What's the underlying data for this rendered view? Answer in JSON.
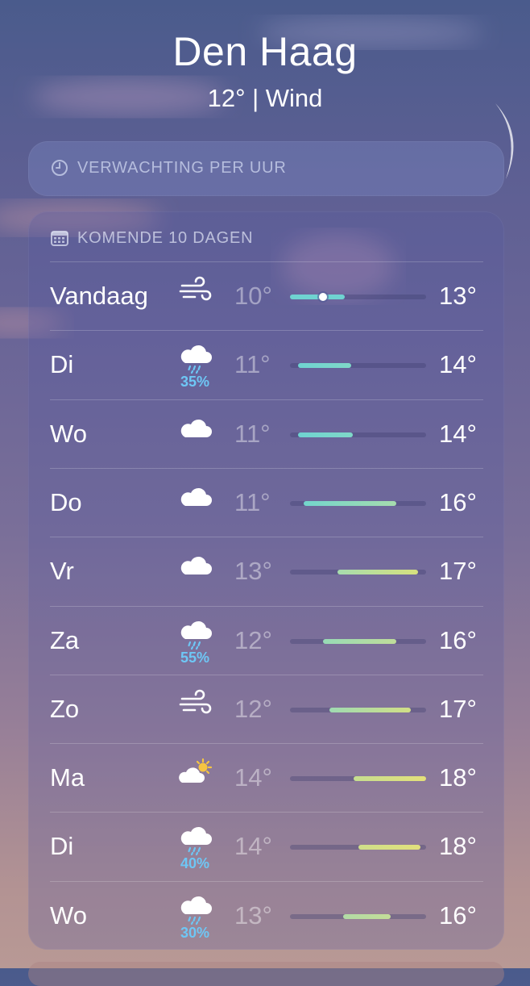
{
  "location": {
    "city": "Den Haag",
    "conditions": "12° | Wind"
  },
  "hourly_forecast": {
    "title": "VERWACHTING PER UUR",
    "icon": "clock-icon"
  },
  "daily_forecast": {
    "title": "KOMENDE 10 DAGEN",
    "icon": "calendar-icon",
    "days": [
      {
        "day": "Vandaag",
        "icon": "wind-icon",
        "precip": "",
        "low": "10°",
        "high": "13°",
        "bar_start": 0.0,
        "bar_end": 0.4,
        "current_marker": 0.24,
        "color_a": "#6fd3d1",
        "color_b": "#6fd3d1"
      },
      {
        "day": "Di",
        "icon": "rain-cloud-icon",
        "precip": "35%",
        "low": "11°",
        "high": "14°",
        "bar_start": 0.06,
        "bar_end": 0.45,
        "current_marker": null,
        "color_a": "#6fd3d1",
        "color_b": "#7fd8c8"
      },
      {
        "day": "Wo",
        "icon": "cloud-icon",
        "precip": "",
        "low": "11°",
        "high": "14°",
        "bar_start": 0.06,
        "bar_end": 0.46,
        "current_marker": null,
        "color_a": "#6fd3d1",
        "color_b": "#7fd8c8"
      },
      {
        "day": "Do",
        "icon": "cloud-icon",
        "precip": "",
        "low": "11°",
        "high": "16°",
        "bar_start": 0.1,
        "bar_end": 0.78,
        "current_marker": null,
        "color_a": "#73d5cc",
        "color_b": "#a6dcae"
      },
      {
        "day": "Vr",
        "icon": "cloud-icon",
        "precip": "",
        "low": "13°",
        "high": "17°",
        "bar_start": 0.35,
        "bar_end": 0.94,
        "current_marker": null,
        "color_a": "#a6dcae",
        "color_b": "#d6e07e"
      },
      {
        "day": "Za",
        "icon": "rain-cloud-icon",
        "precip": "55%",
        "low": "12°",
        "high": "16°",
        "bar_start": 0.24,
        "bar_end": 0.78,
        "current_marker": null,
        "color_a": "#97dab6",
        "color_b": "#bfdd9a"
      },
      {
        "day": "Zo",
        "icon": "wind-icon",
        "precip": "",
        "low": "12°",
        "high": "17°",
        "bar_start": 0.29,
        "bar_end": 0.89,
        "current_marker": null,
        "color_a": "#9fdab2",
        "color_b": "#d2df86"
      },
      {
        "day": "Ma",
        "icon": "sun-behind-cloud-icon",
        "precip": "",
        "low": "14°",
        "high": "18°",
        "bar_start": 0.47,
        "bar_end": 1.0,
        "current_marker": null,
        "color_a": "#c6de90",
        "color_b": "#e4e07a"
      },
      {
        "day": "Di",
        "icon": "rain-cloud-icon",
        "precip": "40%",
        "low": "14°",
        "high": "18°",
        "bar_start": 0.5,
        "bar_end": 0.96,
        "current_marker": null,
        "color_a": "#cfdf8a",
        "color_b": "#e2e07c"
      },
      {
        "day": "Wo",
        "icon": "rain-cloud-icon",
        "precip": "30%",
        "low": "13°",
        "high": "16°",
        "bar_start": 0.39,
        "bar_end": 0.74,
        "current_marker": null,
        "color_a": "#b2dca6",
        "color_b": "#c4dd98"
      }
    ]
  }
}
